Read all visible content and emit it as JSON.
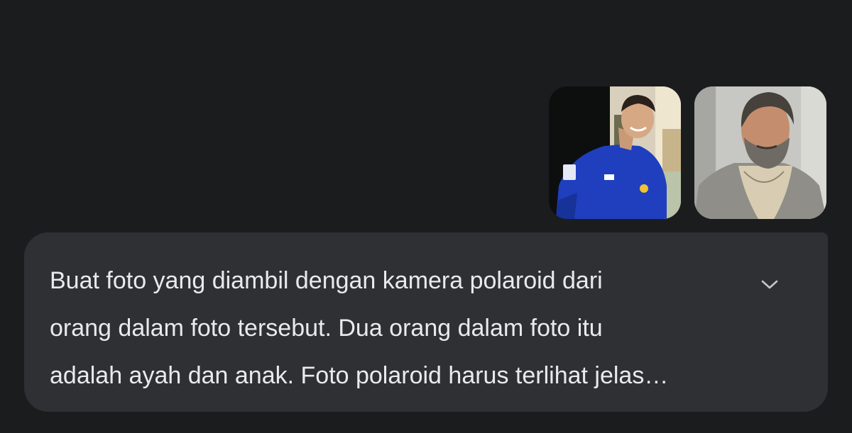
{
  "attachments": [
    {
      "kind": "image",
      "icon": "photo-of-young-man-in-blue-jersey"
    },
    {
      "kind": "image",
      "icon": "photo-of-bearded-older-man"
    }
  ],
  "message": {
    "lines": [
      "Buat foto yang diambil dengan kamera polaroid dari",
      "orang dalam foto tersebut. Dua orang dalam foto itu",
      "adalah ayah dan anak. Foto polaroid harus terlihat jelas…"
    ],
    "expand_icon": "chevron-down-icon"
  },
  "colors": {
    "background": "#1b1c1e",
    "bubble": "#2f3033",
    "text": "#e8eaed"
  }
}
